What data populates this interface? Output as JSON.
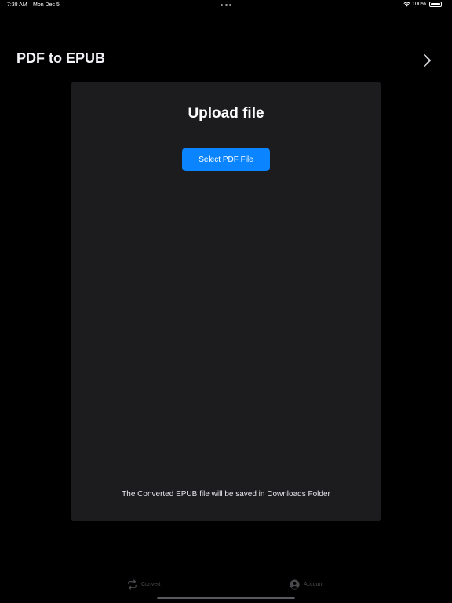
{
  "status_bar": {
    "time": "7:38 AM",
    "date": "Mon Dec 5",
    "battery": "100%",
    "icons": [
      "more-dots-icon",
      "wifi-icon",
      "battery-icon"
    ]
  },
  "header": {
    "title": "PDF to EPUB",
    "next_icon": "chevron-right-icon"
  },
  "card": {
    "title": "Upload file",
    "select_button_label": "Select PDF File",
    "footer_note": "The Converted EPUB file will be saved in Downloads Folder"
  },
  "tab_bar": {
    "tabs": [
      {
        "label": "Convert",
        "icon": "convert-arrows-icon"
      },
      {
        "label": "Account",
        "icon": "account-icon"
      }
    ]
  },
  "colors": {
    "background": "#000000",
    "card": "#1c1c1e",
    "accent": "#0a84ff",
    "tab_inactive": "#4a4a4e"
  }
}
